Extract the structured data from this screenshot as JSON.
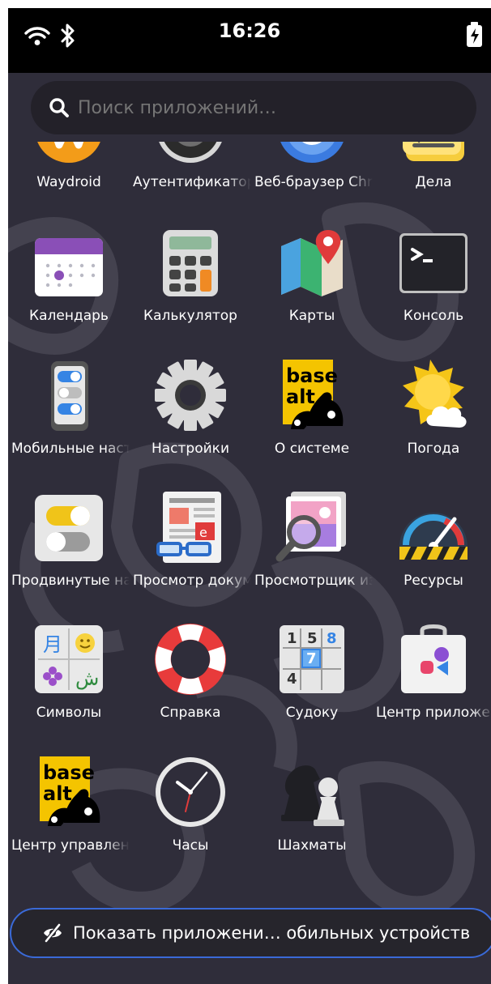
{
  "status_bar": {
    "time": "16:26",
    "icons": [
      "wifi-icon",
      "bluetooth-icon",
      "battery-charging-icon"
    ]
  },
  "search": {
    "placeholder": "Поиск приложений…",
    "icon": "search-icon"
  },
  "apps": [
    {
      "label": "Waydroid",
      "icon": "waydroid-icon"
    },
    {
      "label": "Аутентификатор",
      "icon": "authenticator-icon"
    },
    {
      "label": "Веб-браузер Chromium",
      "icon": "web-browser-icon"
    },
    {
      "label": "Дела",
      "icon": "todo-icon"
    },
    {
      "label": "Календарь",
      "icon": "calendar-icon"
    },
    {
      "label": "Калькулятор",
      "icon": "calculator-icon"
    },
    {
      "label": "Карты",
      "icon": "maps-icon"
    },
    {
      "label": "Консоль",
      "icon": "console-icon"
    },
    {
      "label": "Мобильные настройки",
      "icon": "mobile-settings-icon"
    },
    {
      "label": "Настройки",
      "icon": "settings-gear-icon"
    },
    {
      "label": "О системе",
      "icon": "basealt-logo-icon"
    },
    {
      "label": "Погода",
      "icon": "weather-icon"
    },
    {
      "label": "Продвинутые настройки",
      "icon": "tweaks-toggle-icon"
    },
    {
      "label": "Просмотр документов",
      "icon": "document-viewer-icon"
    },
    {
      "label": "Просмотрщик изображений",
      "icon": "image-viewer-icon"
    },
    {
      "label": "Ресурсы",
      "icon": "resources-gauge-icon"
    },
    {
      "label": "Символы",
      "icon": "characters-icon"
    },
    {
      "label": "Справка",
      "icon": "help-lifebuoy-icon"
    },
    {
      "label": "Судоку",
      "icon": "sudoku-icon"
    },
    {
      "label": "Центр приложений",
      "icon": "software-center-icon"
    },
    {
      "label": "Центр управления",
      "icon": "basealt-logo-icon"
    },
    {
      "label": "Часы",
      "icon": "clock-icon"
    },
    {
      "label": "Шахматы",
      "icon": "chess-icon"
    }
  ],
  "bottom_button": {
    "label": "Показать приложени… обильных устройств",
    "icon": "eye-slash-icon"
  },
  "colors": {
    "background": "#2f2d3a",
    "accent_border": "#3a6ad8"
  }
}
